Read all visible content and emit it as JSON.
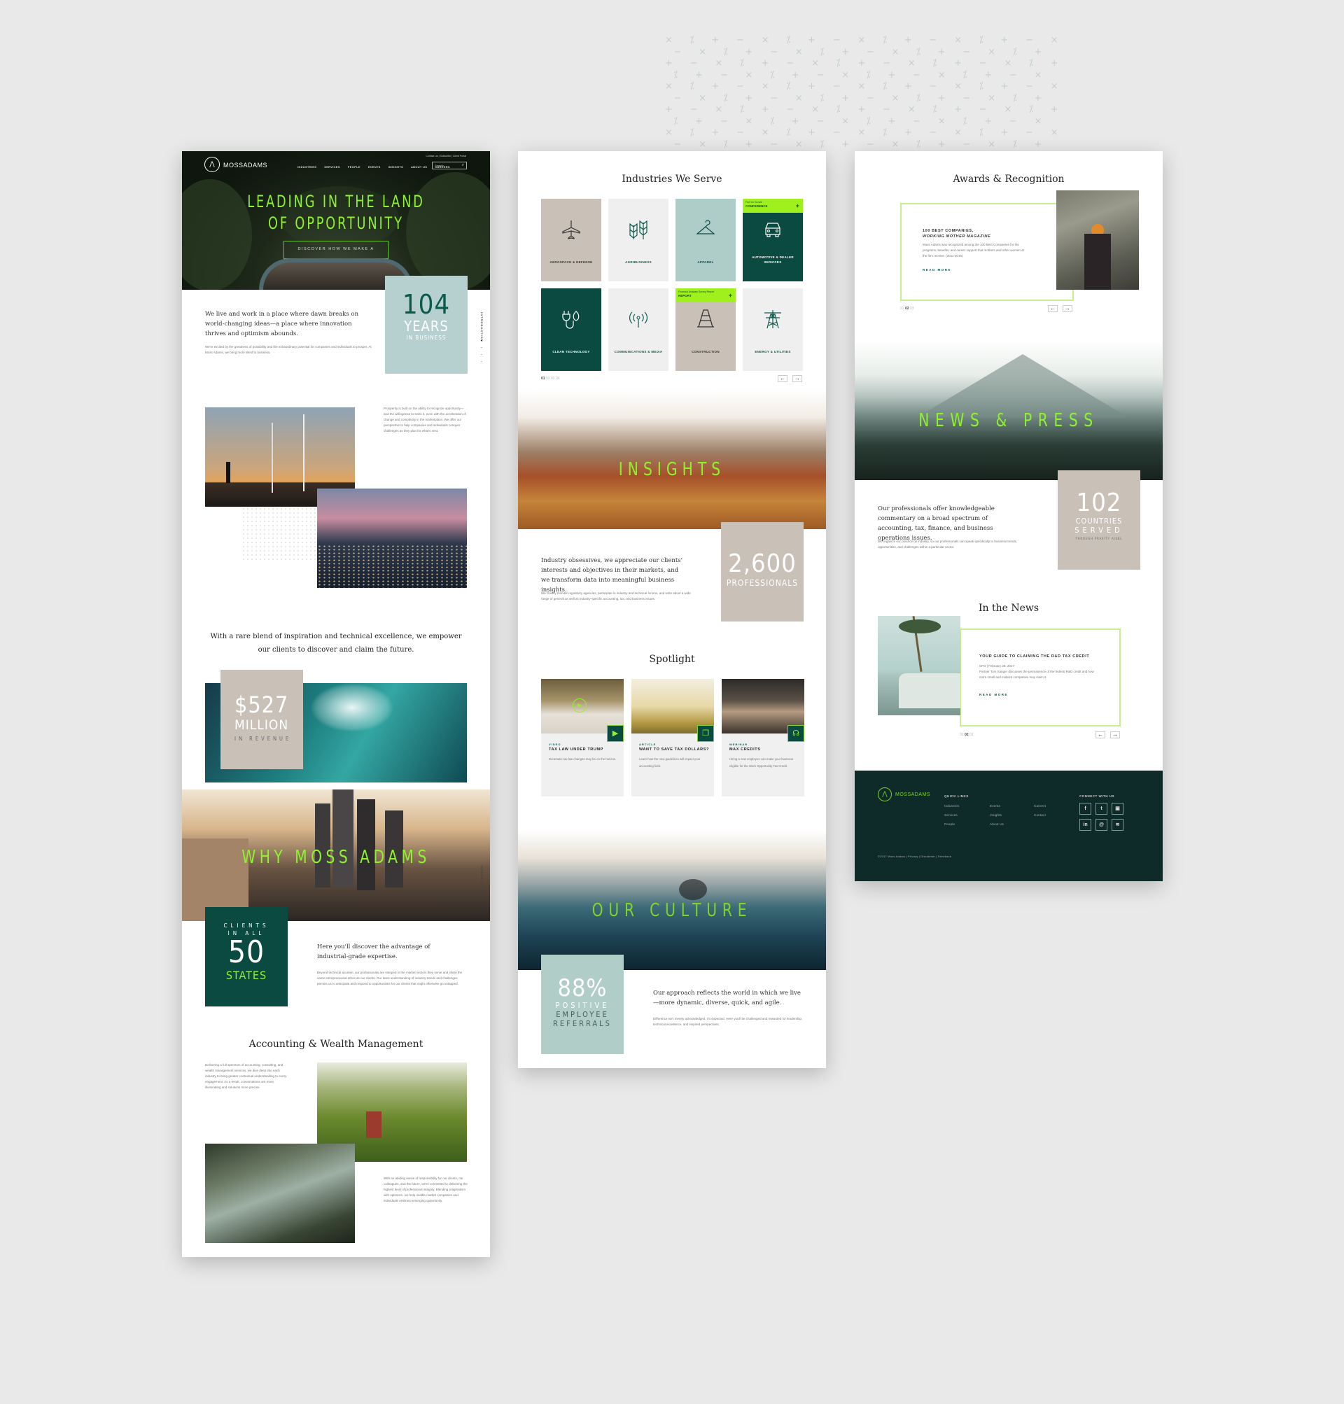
{
  "background_pattern": "×  ⁒  +  −  ×  ⁒  +  −  ×  ⁒  +  −  ×  ⁒  +  −  ×",
  "brand": {
    "name": "MOSSADAMS",
    "accent": "#8ff22e",
    "dark": "#0b4a40",
    "teal_light": "#b6cfcf",
    "taupe": "#cbc1b8"
  },
  "page1": {
    "utility_links": "Contact Us  |  Subscribe  |  Client Portal",
    "nav": [
      "INDUSTRIES",
      "SERVICES",
      "PEOPLE",
      "EVENTS",
      "INSIGHTS",
      "ABOUT US",
      "CAREERS"
    ],
    "search_placeholder": "Search",
    "hero_title_line1": "LEADING IN THE LAND",
    "hero_title_line2": "OF OPPORTUNITY",
    "hero_button": "DISCOVER HOW WE MAKE A DIFFERENCE",
    "stat_years": {
      "number": "104",
      "line1": "YEARS",
      "line2": "IN BUSINESS"
    },
    "intro_lead": "We live and work in a place where dawn breaks on world-changing ideas—a place where innovation thrives and optimism abounds.",
    "intro_body": "We're excited by the greatness of possibility and the extraordinary potential for companies and individuals to prosper. At Moss Adams, we bring more West to business.",
    "side_label": "INTRODUCTION",
    "prosperity_text": "Prosperity is built on the ability to recognize opportunity—and the willingness to seize it, even with the acceleration of change and complexity in the marketplace. We offer our perspective to help companies and individuals conquer challenges as they plan for what's next.",
    "blend_quote": "With a rare blend of inspiration and technical excellence, we empower our clients to discover and claim the future.",
    "stat_revenue": {
      "number": "$527",
      "line1": "MILLION",
      "line2": "IN REVENUE"
    },
    "why_title": "WHY MOSS ADAMS",
    "stat_states": {
      "line1": "CLIENTS",
      "line2": "IN ALL",
      "number": "50",
      "line3": "STATES"
    },
    "advantage_lead": "Here you'll discover the advantage of industrial-grade expertise.",
    "advantage_body": "Beyond technical acumen, our professionals are steeped in the market sectors they serve and share the same entrepreneurial ethos as our clients. Our keen understanding of industry trends and challenges permits us to anticipate and respond to opportunities for our clients that might otherwise go untapped.",
    "awm_title": "Accounting & Wealth Management",
    "awm_text1": "Delivering a full spectrum of accounting, consulting, and wealth management services, we dive deep into each industry to bring greater contextual understanding to every engagement. As a result, conversations are more illuminating and solutions more precise.",
    "awm_text2": "With an abiding sense of responsibility for our clients, our colleagues, and the future, we're committed to delivering the highest level of professional integrity. Blending pragmatism with optimism, we help middle-market companies and individuals embrace emerging opportunity."
  },
  "page2": {
    "industries_title": "Industries We Serve",
    "industries": [
      {
        "label": "AEROSPACE & DEFENSE",
        "icon": "airplane-icon"
      },
      {
        "label": "AGRIBUSINESS",
        "icon": "wheat-icon"
      },
      {
        "label": "APPAREL",
        "icon": "hanger-icon"
      },
      {
        "label": "AUTOMOTIVE & DEALER SERVICES",
        "icon": "car-icon",
        "tag_small": "Fuel for Growth",
        "tag_big": "CONFERENCE"
      },
      {
        "label": "CLEAN TECHNOLOGY",
        "icon": "plug-leaf-icon"
      },
      {
        "label": "COMMUNICATIONS & MEDIA",
        "icon": "antenna-icon"
      },
      {
        "label": "CONSTRUCTION",
        "icon": "traffic-cone-icon",
        "tag_small": "Financial Analysis Survey Report",
        "tag_big": "REPORT"
      },
      {
        "label": "ENERGY & UTILITIES",
        "icon": "power-tower-icon"
      }
    ],
    "industries_pager": [
      "01",
      "02",
      "03",
      "04"
    ],
    "insights_title": "INSIGHTS",
    "insights_lead": "Industry obsessives, we appreciate our clients' interests and objectives in their markets, and we transform data into meaningful business insights.",
    "insights_body": "We closely monitor regulatory agencies, participate in industry and technical forums, and write about a wide range of general as well as industry-specific accounting, tax, and business issues.",
    "stat_professionals": {
      "number": "2,600",
      "line1": "PROFESSIONALS"
    },
    "spotlight_title": "Spotlight",
    "spotlight": [
      {
        "category": "VIDEO",
        "title": "TAX LAW UNDER TRUMP",
        "desc": "Deramatic tax law changes may be on the horizon."
      },
      {
        "category": "ARTICLE",
        "title": "WANT TO SAVE TAX DOLLARS?",
        "desc": "Learn how the new guidelines will impact your accounting field."
      },
      {
        "category": "WEBINAR",
        "title": "MAX CREDITS",
        "desc": "Hiring a new employee can make your business eligible for the Work Opportunity Tax Credit."
      }
    ],
    "culture_title": "OUR CULTURE",
    "stat_referrals": {
      "number": "88%",
      "line1": "POSITIVE",
      "line2": "EMPLOYEE",
      "line3": "REFERRALS"
    },
    "culture_lead": "Our approach reflects the world in which we live—more dynamic, diverse, quick, and agile.",
    "culture_body": "Difference isn't merely acknowledged, it's expected. Here you'll be challenged and rewarded for leadership, technical excellence, and inspired perspectives."
  },
  "page3": {
    "awards_title": "Awards & Recognition",
    "award_title1": "100 BEST COMPANIES,",
    "award_title2": "WORKING MOTHER MAGAZINE",
    "award_body": "Moss Adams was recognized among the 100 Best Companies for the programs, benefits, and career support that mothers and other women at the firm receive. (2011-2016)",
    "read_more": "READ MORE",
    "pager": [
      "01",
      "02",
      "03"
    ],
    "news_title": "NEWS & PRESS",
    "news_lead": "Our professionals offer knowledgeable commentary on a broad spectrum of accounting, tax, finance, and business operations issues.",
    "news_body": "We organize our practice by industry, so our professionals can speak specifically to business trends, opportunities, and challenges within a particular sector.",
    "stat_countries": {
      "number": "102",
      "line1": "COUNTRIES",
      "line2": "SERVED",
      "line3": "THROUGH PRAXITY AISBL"
    },
    "inthenews_title": "In the News",
    "news_item_title": "YOUR GUIDE TO CLAIMING THE R&D TAX CREDIT",
    "news_item_meta": "CFO | February 28, 2017",
    "news_item_body": "Partner Tom Sanger discusses the permanence of the federal R&D credit and how more small and midsize companies may claim it.",
    "footer": {
      "quick_links_heading": "QUICK LINKS",
      "links_col1": [
        "Industries",
        "Services",
        "People"
      ],
      "links_col2": [
        "Events",
        "Insights",
        "About Us"
      ],
      "links_col3": [
        "Careers",
        "Contact"
      ],
      "connect_heading": "CONNECT WITH US",
      "social": [
        "f",
        "t",
        "▣",
        "in",
        "@",
        "≋"
      ],
      "copyright": "©2017 Moss Adams  |  Privacy  |  Disclaimer  |  Feedback"
    }
  }
}
